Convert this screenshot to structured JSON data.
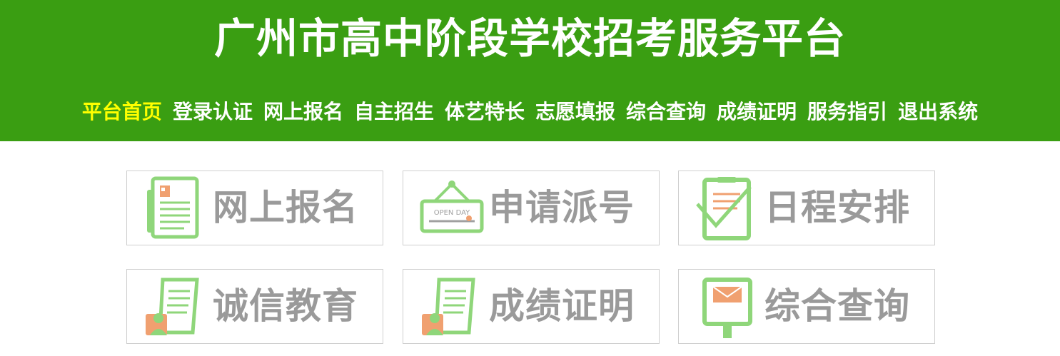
{
  "header": {
    "title": "广州市高中阶段学校招考服务平台",
    "nav": [
      "平台首页",
      "登录认证",
      "网上报名",
      "自主招生",
      "体艺特长",
      "志愿填报",
      "综合查询",
      "成绩证明",
      "服务指引",
      "退出系统"
    ],
    "active_index": 0
  },
  "tiles": [
    {
      "label": "网上报名",
      "icon": "registration-form-icon"
    },
    {
      "label": "申请派号",
      "icon": "open-day-sign-icon"
    },
    {
      "label": "日程安排",
      "icon": "schedule-clipboard-icon"
    },
    {
      "label": "诚信教育",
      "icon": "integrity-document-user-icon"
    },
    {
      "label": "成绩证明",
      "icon": "score-certificate-user-icon"
    },
    {
      "label": "综合查询",
      "icon": "mailbox-query-icon"
    }
  ],
  "colors": {
    "header_bg": "#3a9e12",
    "nav_active": "#ffff00",
    "icon_green": "#8fd67a",
    "icon_orange": "#f0a070",
    "tile_text": "#9a9a9a"
  },
  "icon_text": {
    "open_day": "OPEN DAY"
  }
}
